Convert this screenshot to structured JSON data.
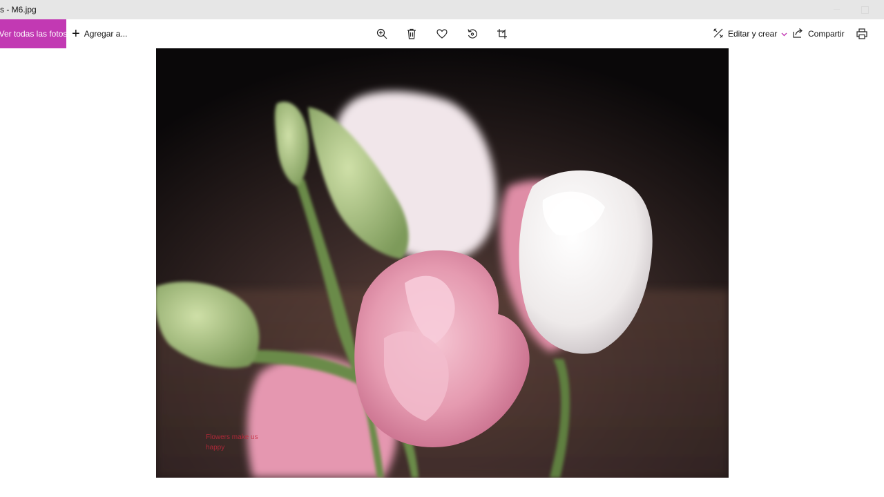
{
  "window": {
    "title": "s - M6.jpg"
  },
  "toolbar": {
    "view_all_label": "Ver todas las fotos",
    "add_label": "Agregar a...",
    "edit_label": "Editar y crear",
    "share_label": "Compartir",
    "icons": [
      "zoom-icon",
      "delete-icon",
      "favorite-icon",
      "rotate-icon",
      "crop-icon",
      "edit-create-icon",
      "chevron-down-icon",
      "share-icon",
      "print-icon"
    ],
    "accent_color": "#c239b3"
  },
  "photo": {
    "watermark_line1": "Flowers make us",
    "watermark_line2": "happy"
  }
}
